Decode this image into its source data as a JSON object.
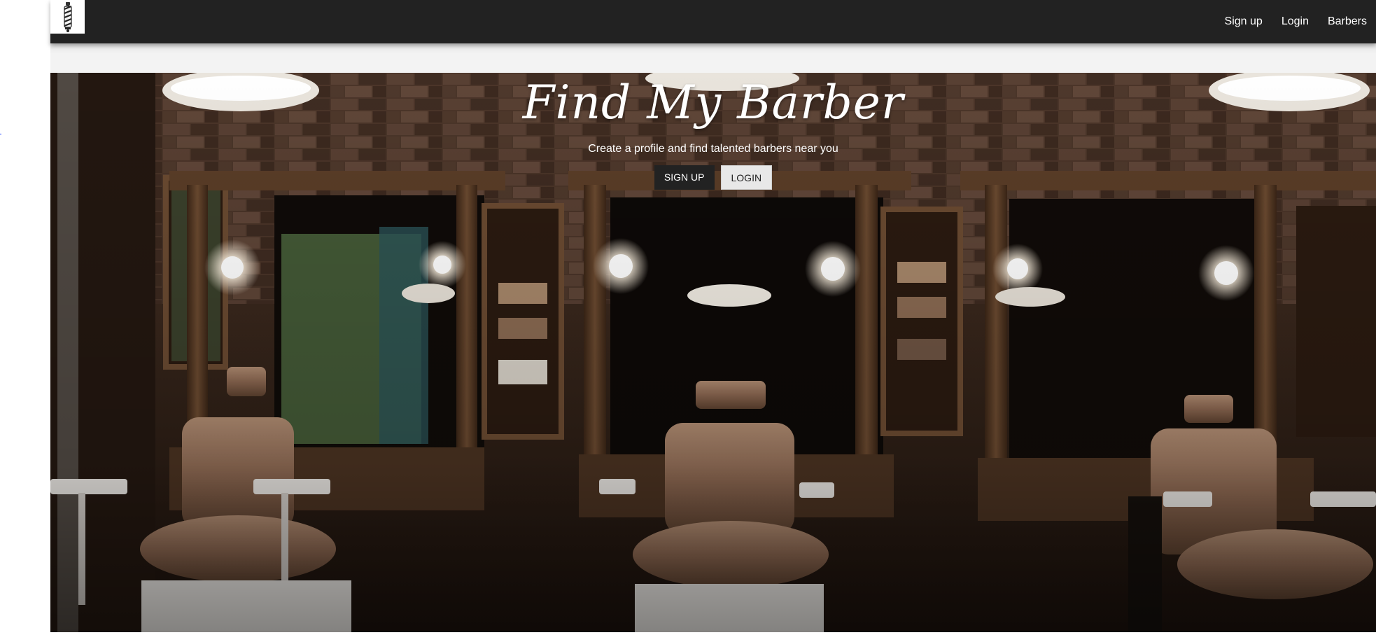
{
  "navbar": {
    "logo_icon": "barber-pole-icon",
    "links": [
      {
        "label": "Sign up"
      },
      {
        "label": "Login"
      },
      {
        "label": "Barbers"
      }
    ],
    "background": "#222222"
  },
  "hero": {
    "title": "Find My Barber",
    "subtitle": "Create a profile and find talented barbers near you",
    "signup_button": "SIGN UP",
    "login_button": "LOGIN",
    "background_image": "barbershop-interior-photo"
  },
  "colors": {
    "accent_dark": "#222222",
    "button_light": "#e8e8e8",
    "text_light": "#ffffff"
  }
}
